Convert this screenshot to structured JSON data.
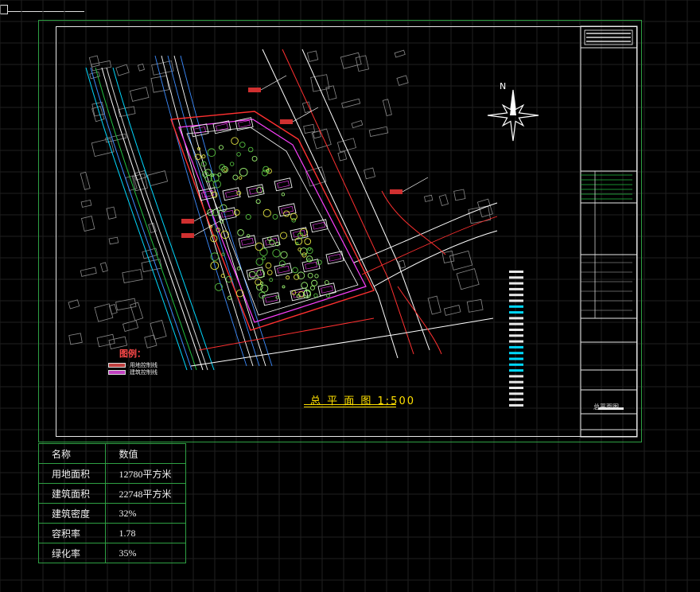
{
  "drawing": {
    "title": "总 平 面 图 1:500",
    "north_label": "N",
    "legend": {
      "title": "图例：",
      "items": [
        {
          "label": "用地控制线",
          "color": "#ff4040"
        },
        {
          "label": "建筑控制线",
          "color": "#ff40ff"
        }
      ]
    },
    "colors": {
      "site_boundary": "#ff3030",
      "building_control": "#ff40ff",
      "roads": "#ffffff",
      "vegetation": "#7fe060",
      "water_channel": "#00d8ff",
      "frame": "#2ea043",
      "title": "#ffe000"
    },
    "title_block": {
      "sheet_name": "总平面图"
    }
  },
  "stats_table": {
    "headers": [
      "名称",
      "数值"
    ],
    "rows": [
      [
        "用地面积",
        "12780平方米"
      ],
      [
        "建筑面积",
        "22748平方米"
      ],
      [
        "建筑密度",
        "32%"
      ],
      [
        "容积率",
        "1.78"
      ],
      [
        "绿化率",
        "35%"
      ]
    ]
  }
}
